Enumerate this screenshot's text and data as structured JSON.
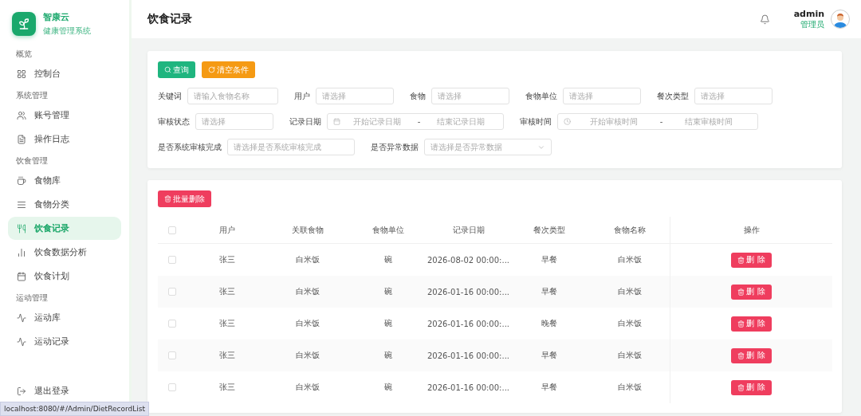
{
  "brand": {
    "name": "智康云",
    "subtitle": "健康管理系统"
  },
  "sidebar": {
    "groups": [
      {
        "title": "概览",
        "items": [
          {
            "label": "控制台",
            "selected": false
          }
        ]
      },
      {
        "title": "系统管理",
        "items": [
          {
            "label": "账号管理",
            "selected": false
          },
          {
            "label": "操作日志",
            "selected": false
          }
        ]
      },
      {
        "title": "饮食管理",
        "items": [
          {
            "label": "食物库",
            "selected": false
          },
          {
            "label": "食物分类",
            "selected": false
          },
          {
            "label": "饮食记录",
            "selected": true
          },
          {
            "label": "饮食数据分析",
            "selected": false
          },
          {
            "label": "饮食计划",
            "selected": false
          }
        ]
      },
      {
        "title": "运动管理",
        "items": [
          {
            "label": "运动库",
            "selected": false
          },
          {
            "label": "运动记录",
            "selected": false
          }
        ]
      }
    ],
    "logout": "退出登录"
  },
  "header": {
    "title": "饮食记录",
    "user": {
      "name": "admin",
      "role": "管理员"
    }
  },
  "filters": {
    "buttons": [
      {
        "label": "查询",
        "kind": "search"
      },
      {
        "label": "清空条件",
        "kind": "reset"
      }
    ],
    "fields": [
      {
        "label": "关键词",
        "kind": "text",
        "placeholder": "请输入食物名称"
      },
      {
        "label": "用户",
        "kind": "select",
        "placeholder": "请选择"
      },
      {
        "label": "食物",
        "kind": "select",
        "placeholder": "请选择"
      },
      {
        "label": "食物单位",
        "kind": "select",
        "placeholder": "请选择"
      },
      {
        "label": "餐次类型",
        "kind": "select",
        "placeholder": "请选择"
      },
      {
        "label": "审核状态",
        "kind": "select",
        "placeholder": "请选择"
      },
      {
        "label": "记录日期",
        "kind": "daterange",
        "start": "开始记录日期",
        "separator": "-",
        "end": "结束记录日期"
      },
      {
        "label": "审核时间",
        "kind": "timerange",
        "start": "开始审核时间",
        "separator": "-",
        "end": "结束审核时间"
      },
      {
        "label": "是否系统审核完成",
        "kind": "wideselect",
        "placeholder": "请选择是否系统审核完成"
      },
      {
        "label": "是否异常数据",
        "kind": "dropdown",
        "placeholder": "请选择是否异常数据"
      }
    ]
  },
  "table": {
    "batch_delete": "批量删除",
    "select_all": {
      "checked": false
    },
    "columns": [
      "用户",
      "关联食物",
      "食物单位",
      "记录日期",
      "餐次类型",
      "食物名称",
      "操作"
    ],
    "rows": [
      {
        "checked": false,
        "cells": [
          "张三",
          "白米饭",
          "碗",
          "2026-08-02 00:00:...",
          "早餐",
          "白米饭"
        ],
        "action": "删 除"
      },
      {
        "checked": false,
        "cells": [
          "张三",
          "白米饭",
          "碗",
          "2026-01-16 00:00:...",
          "早餐",
          "白米饭"
        ],
        "action": "删 除"
      },
      {
        "checked": false,
        "cells": [
          "张三",
          "白米饭",
          "碗",
          "2026-01-16 00:00:...",
          "晚餐",
          "白米饭"
        ],
        "action": "删 除"
      },
      {
        "checked": false,
        "cells": [
          "张三",
          "白米饭",
          "碗",
          "2026-01-16 00:00:...",
          "早餐",
          "白米饭"
        ],
        "action": "删 除"
      },
      {
        "checked": false,
        "cells": [
          "张三",
          "白米饭",
          "碗",
          "2026-01-16 00:00:...",
          "早餐",
          "白米饭"
        ],
        "action": "删 除"
      }
    ]
  },
  "status_bar": "localhost:8080/#/Admin/DietRecordList"
}
